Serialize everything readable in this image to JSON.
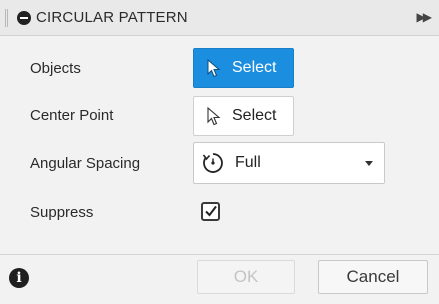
{
  "dialog": {
    "title": "CIRCULAR PATTERN",
    "icons": {
      "grip": "drag-grip-icon",
      "title": "minus-circle-icon",
      "expand": "double-chevron-right-icon"
    }
  },
  "rows": {
    "objects": {
      "label": "Objects",
      "button_label": "Select",
      "state": "active",
      "icon": "cursor-arrow-icon"
    },
    "center_point": {
      "label": "Center Point",
      "button_label": "Select",
      "state": "idle",
      "icon": "cursor-arrow-icon"
    },
    "angular_spacing": {
      "label": "Angular Spacing",
      "value": "Full",
      "icon": "circular-arrow-icon"
    },
    "suppress": {
      "label": "Suppress",
      "checked": true
    }
  },
  "footer": {
    "info_symbol": "i",
    "ok_label": "OK",
    "ok_enabled": false,
    "cancel_label": "Cancel"
  },
  "colors": {
    "accent": "#1c8ee0",
    "background": "#f2f2f2",
    "titlebar": "#e9e9e9"
  }
}
